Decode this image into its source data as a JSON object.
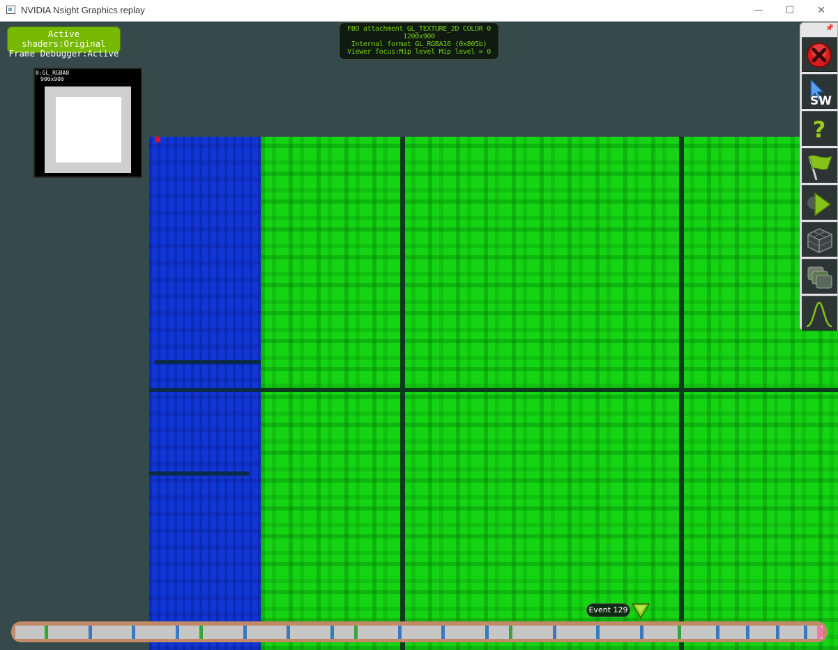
{
  "window": {
    "title": "NVIDIA Nsight Graphics replay",
    "controls": {
      "minimize": "—",
      "maximize": "☐",
      "close": "✕"
    }
  },
  "status_pill": {
    "line1": "Active shaders:Original",
    "line2": "Frame Debugger:Active",
    "color": "#76b900"
  },
  "fbo_info": {
    "line1": "FBO attachment GL_TEXTURE_2D COLOR 0",
    "line2": "1200x900",
    "line3": "Internal format GL_RGBA16 (0x805b)",
    "line4": "Viewer focus:Mip level Mip level = 0",
    "color": "#76d014"
  },
  "thumbnail": {
    "label": "0:GL_RGBA8",
    "size": "900x900"
  },
  "toolbar": {
    "pin_icon": "pin-icon",
    "buttons": [
      {
        "name": "close-capture-button",
        "icon": "red-x-icon"
      },
      {
        "name": "cursor-sw-button",
        "icon": "cursor-arrow-icon",
        "label": "SW"
      },
      {
        "name": "help-button",
        "icon": "question-mark-icon"
      },
      {
        "name": "flag-button",
        "icon": "flag-icon"
      },
      {
        "name": "play-button",
        "icon": "play-icon"
      },
      {
        "name": "geometry-button",
        "icon": "wireframe-cube-icon"
      },
      {
        "name": "render-targets-button",
        "icon": "layers-icon"
      },
      {
        "name": "histogram-button",
        "icon": "bell-curve-icon"
      }
    ]
  },
  "timeline": {
    "event_label": "Event 129",
    "frame_color": "#c38a67",
    "track_color": "#c6c6c6",
    "marker_color": "#8ccc1a"
  }
}
